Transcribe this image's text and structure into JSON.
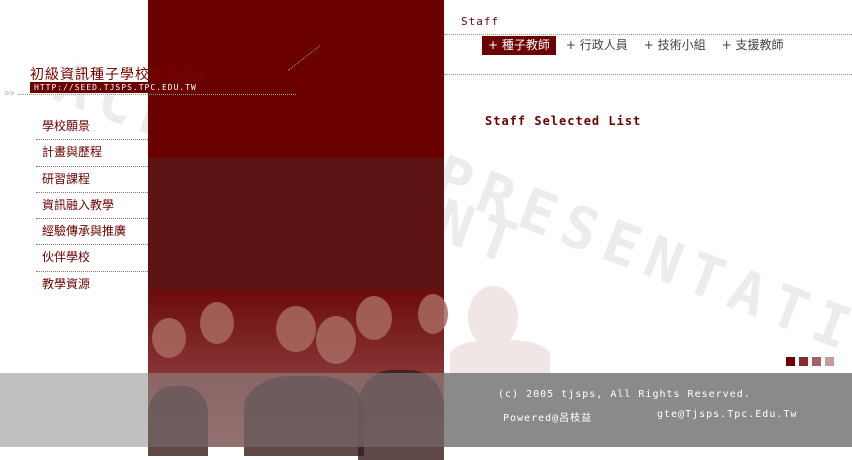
{
  "watermark": {
    "line1": "ACHIEVEMENT",
    "line2": "PRESENTATION"
  },
  "site": {
    "title": "初級資訊種子學校成果展示",
    "url": "HTTP://SEED.TJSPS.TPC.EDU.TW"
  },
  "sidebar": {
    "items": [
      {
        "label": "學校願景"
      },
      {
        "label": "計畫與歷程"
      },
      {
        "label": "研習課程"
      },
      {
        "label": "資訊融入教學"
      },
      {
        "label": "經驗傳承與推廣"
      },
      {
        "label": "伙伴學校"
      },
      {
        "label": "教學資源"
      }
    ]
  },
  "staff": {
    "label": "Staff",
    "tabs": [
      {
        "label": "+ 種子教師",
        "active": true
      },
      {
        "label": "+ 行政人員",
        "active": false
      },
      {
        "label": "+ 技術小組",
        "active": false
      },
      {
        "label": "+ 支援教師",
        "active": false
      }
    ],
    "list_title": "Staff Selected List"
  },
  "colors": {
    "primary": "#6b0000",
    "squares": [
      "#6b0000",
      "#8a2b2b",
      "#a66060",
      "#c49a9a"
    ]
  },
  "footer": {
    "copyright": "(c) 2005 tjsps, All Rights Reserved.",
    "powered": "Powered@呂枝益",
    "email": "gte@Tjsps.Tpc.Edu.Tw"
  }
}
